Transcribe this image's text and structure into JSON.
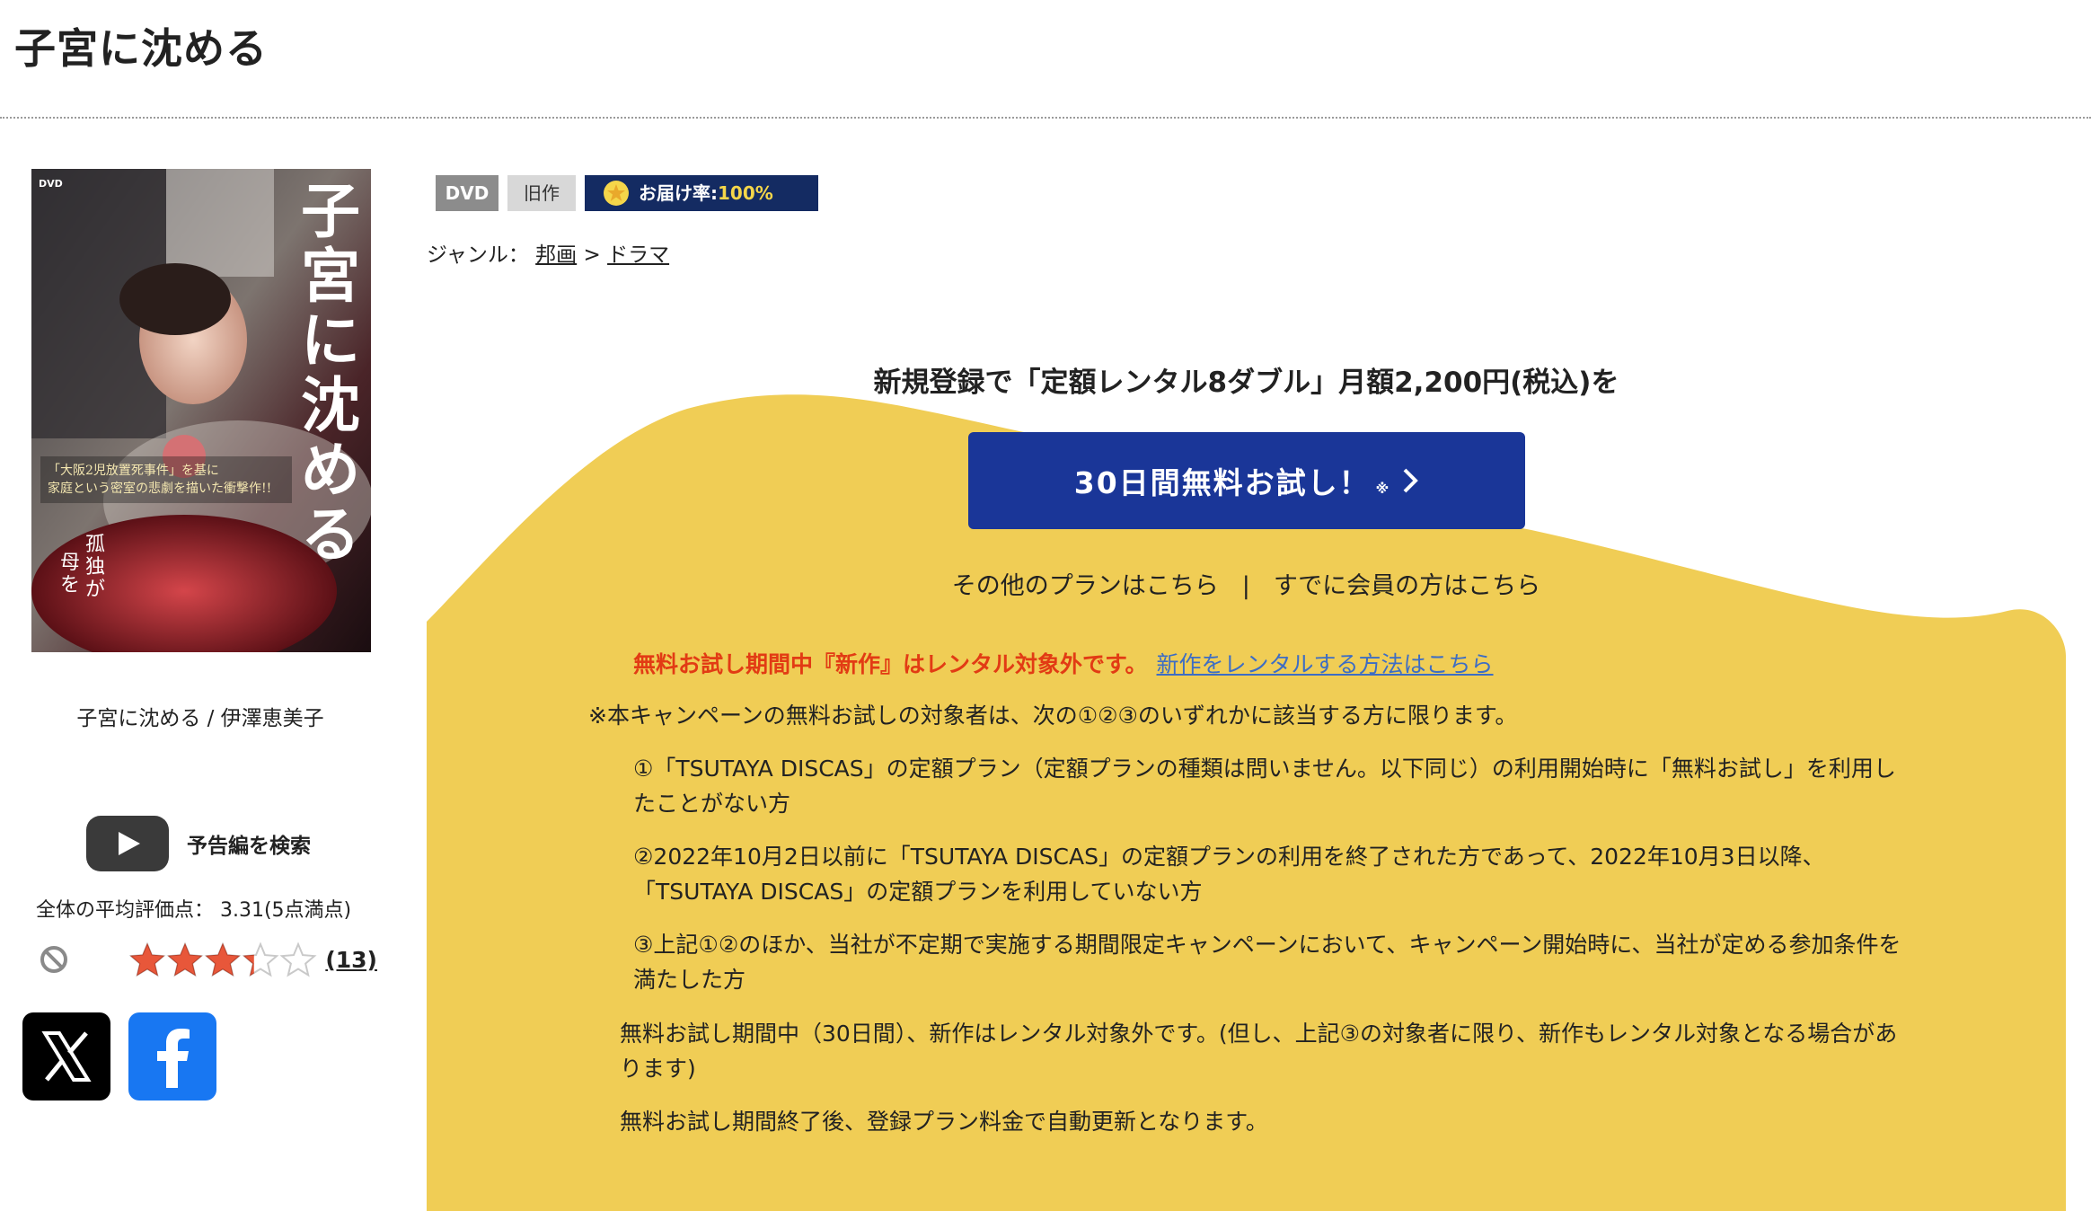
{
  "page": {
    "title": "子宮に沈める"
  },
  "product": {
    "caption": "子宮に沈める / 伊澤恵美子",
    "trailer_label": "予告編を検索",
    "average_rating_text": "全体の平均評価点： 3.31(5点満点)",
    "rating_value": 3.31,
    "rating_max": 5,
    "review_count": "(13)"
  },
  "poster": {
    "title_vertical": "子宮に沈める",
    "tagline": "「大阪2児放置死事件」を基に家庭という密室の悲劇を描いた衝撃作!!",
    "sub_copy": "孤独が、母を追いやる。",
    "format_mark": "DVD"
  },
  "badges": {
    "format": "DVD",
    "age": "旧作",
    "delivery_label": "お届け率: ",
    "delivery_value": "100%"
  },
  "genre": {
    "label": "ジャンル：",
    "items": [
      "邦画",
      "ドラマ"
    ],
    "separator": ">"
  },
  "promo": {
    "headline": "新規登録で「定額レンタル8ダブル」月額2,200円(税込)を",
    "cta_label": "30日間無料お試し！",
    "cta_mark": "※",
    "other_plans_link": "その他のプランはこちら",
    "link_separator": "|",
    "member_link": "すでに会員の方はこちら",
    "warning": "無料お試し期間中『新作』はレンタル対象外です。",
    "warning_link": "新作をレンタルする方法はこちら",
    "eligibility_note": "※本キャンペーンの無料お試しの対象者は、次の①②③のいずれかに該当する方に限ります。",
    "conditions": [
      "①「TSUTAYA DISCAS」の定額プラン（定額プランの種類は問いません。以下同じ）の利用開始時に「無料お試し」を利用したことがない方",
      "②2022年10月2日以前に「TSUTAYA DISCAS」の定額プランの利用を終了された方であって、2022年10月3日以降、「TSUTAYA DISCAS」の定額プランを利用していない方",
      "③上記①②のほか、当社が不定期で実施する期間限定キャンペーンにおいて、キャンペーン開始時に、当社が定める参加条件を満たした方"
    ],
    "trial_note": "無料お試し期間中（30日間）、新作はレンタル対象外です。(但し、上記③の対象者に限り、新作もレンタル対象となる場合があります)",
    "auto_renew_note": "無料お試し期間終了後、登録プラン料金で自動更新となります。"
  },
  "colors": {
    "yellow": "#f0cd55",
    "cta_blue": "#1a3698",
    "badge_navy": "#142b62",
    "warning_red": "#e23b14",
    "link_blue": "#3d6dc4",
    "star_red": "#e8573a"
  },
  "icons": {
    "trailer": "youtube-play-icon",
    "no_rating": "ban-icon",
    "delivery": "star-medal-icon",
    "cta_arrow": "chevron-right-icon",
    "social_x": "x-logo-icon",
    "social_facebook": "facebook-logo-icon"
  }
}
